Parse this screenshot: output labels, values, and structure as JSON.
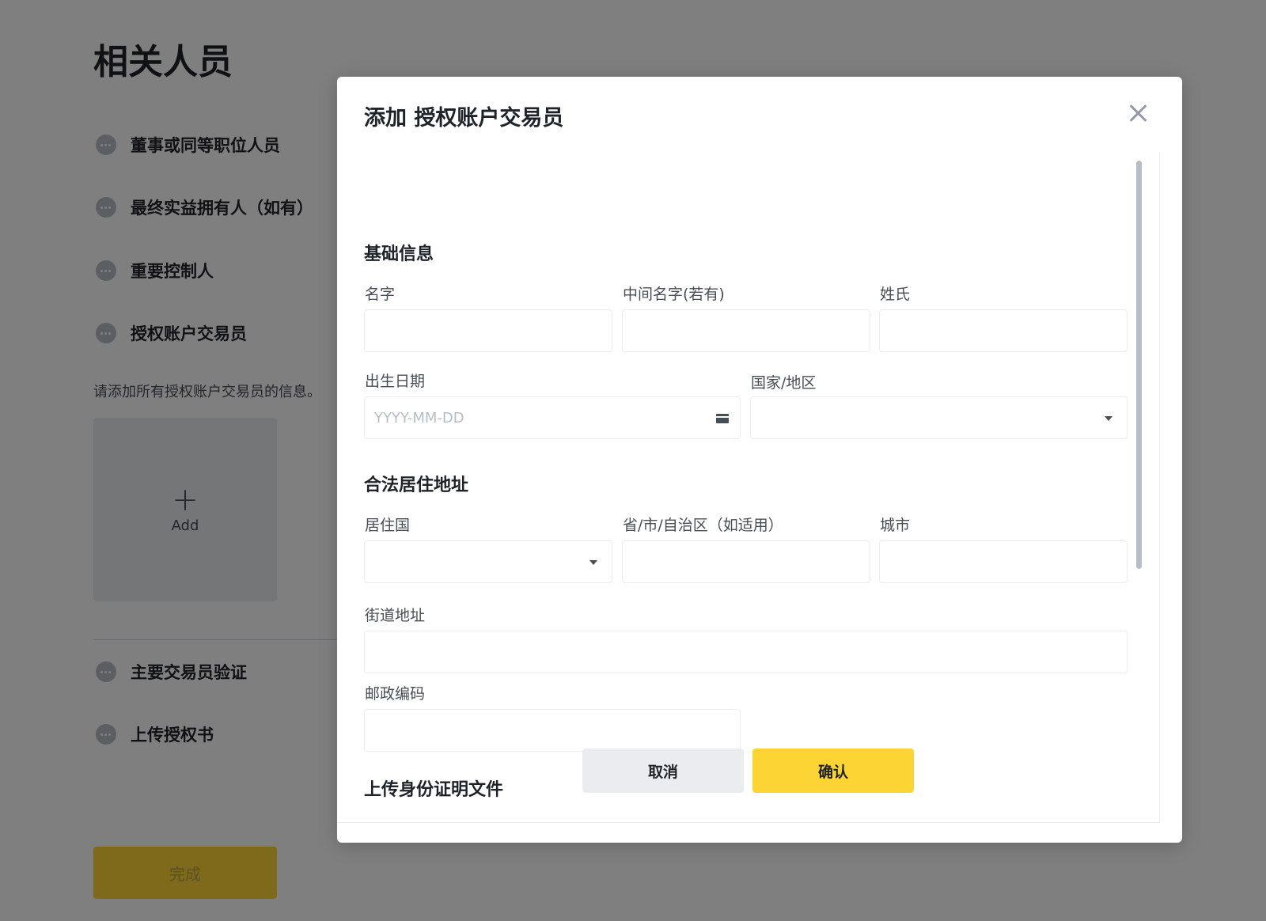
{
  "background": {
    "title": "相关人员",
    "steps": [
      {
        "label": "董事或同等职位人员"
      },
      {
        "label": "最终实益拥有人（如有）"
      },
      {
        "label": "重要控制人"
      },
      {
        "label": "授权账户交易员"
      },
      {
        "label": "主要交易员验证"
      },
      {
        "label": "上传授权书"
      }
    ],
    "hint": "请添加所有授权账户交易员的信息。",
    "add_plus": "+",
    "add_label": "Add",
    "done_label": "完成"
  },
  "modal": {
    "title": "添加 授权账户交易员",
    "basic_section": "基础信息",
    "first_name_label": "名字",
    "middle_name_label": "中间名字(若有)",
    "last_name_label": "姓氏",
    "dob_label": "出生日期",
    "dob_placeholder": "YYYY-MM-DD",
    "country_label": "国家/地区",
    "address_section": "合法居住地址",
    "residence_country_label": "居住国",
    "province_label": "省/市/自治区（如适用）",
    "city_label": "城市",
    "street_label": "街道地址",
    "postal_label": "邮政编码",
    "upload_section": "上传身份证明文件",
    "cancel_label": "取消",
    "confirm_label": "确认"
  },
  "colors": {
    "accent": "#fcd535",
    "overlay": "rgba(0,0,0,0.5)",
    "text": "#1e2329",
    "border": "#eaecef"
  }
}
